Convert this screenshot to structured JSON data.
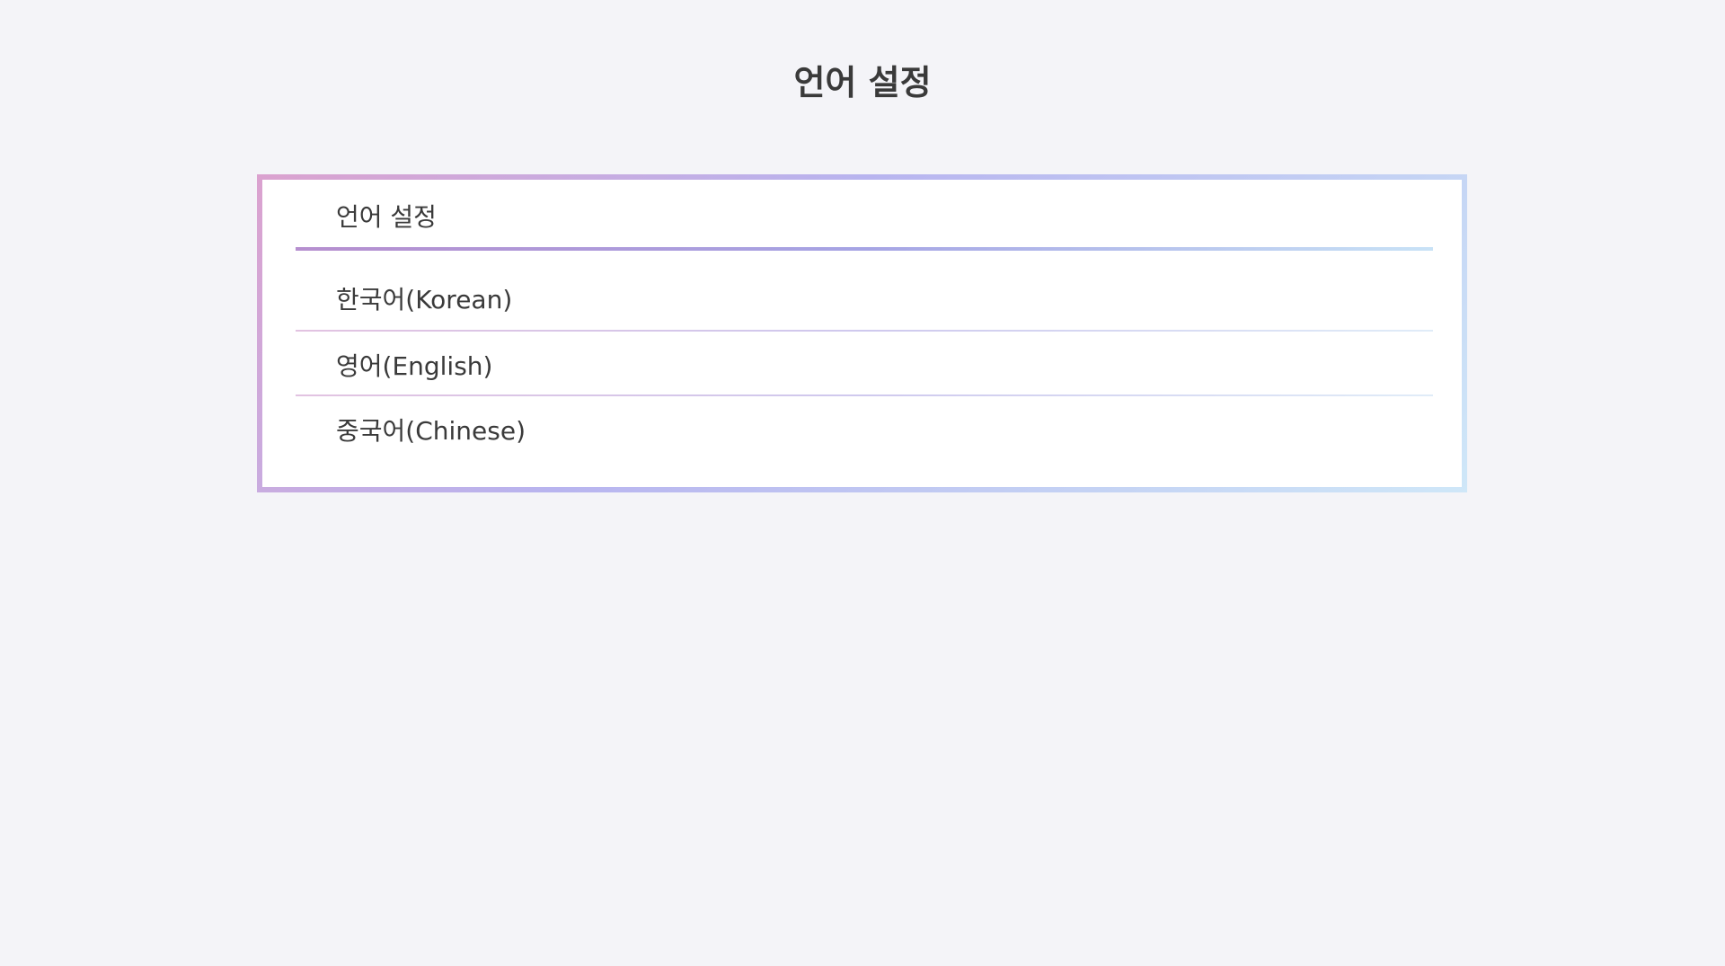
{
  "page": {
    "title": "언어 설정"
  },
  "panel": {
    "header_label": "언어 설정",
    "items": [
      {
        "label": "한국어(Korean)"
      },
      {
        "label": "영어(English)"
      },
      {
        "label": "중국어(Chinese)"
      }
    ]
  },
  "colors": {
    "background": "#f4f4f8",
    "border_gradient": [
      "#dba2cf",
      "#b8b4ef",
      "#cfe7f8"
    ],
    "text": "#3a3a3a"
  }
}
